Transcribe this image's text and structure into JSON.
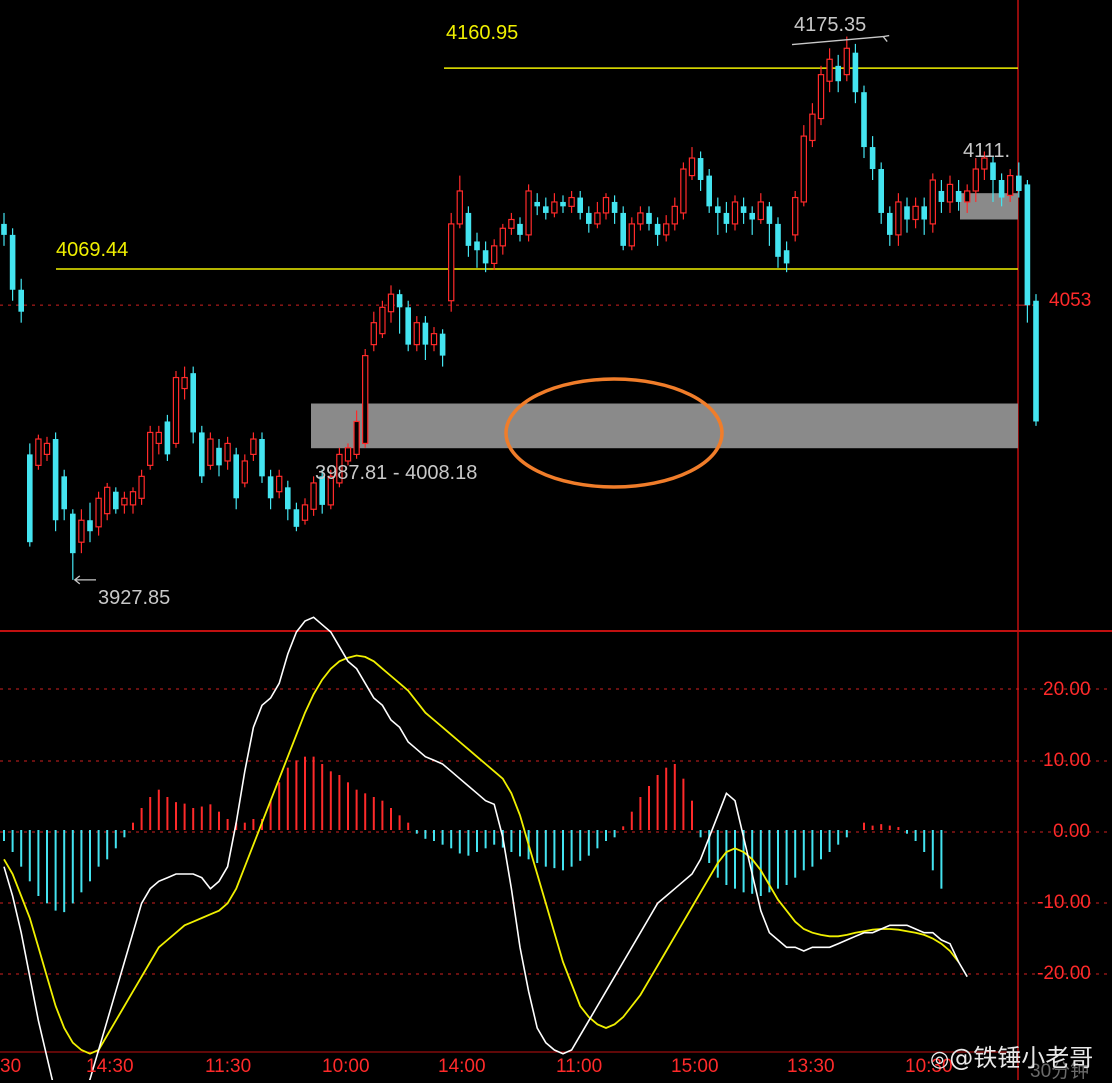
{
  "annotations": {
    "level_high": "4160.95",
    "level_mid": "4069.44",
    "peak_label": "4175.35",
    "low_label": "3927.85",
    "zone_label": "3987.81 - 4008.18",
    "last_price_partial": "4111.",
    "axis_price": "4053"
  },
  "macd_axis": [
    "20.00",
    "10.00",
    "0.00",
    "-10.00",
    "-20.00"
  ],
  "x_ticks": [
    "30",
    "14:30",
    "11:30",
    "10:00",
    "14:00",
    "11:00",
    "15:00",
    "13:30",
    "10:30"
  ],
  "period_label": "30分钟",
  "watermark": "@铁锤小老哥",
  "colors": {
    "up": "#ff2a2a",
    "down": "#44e4f0",
    "level_line": "#f0f000",
    "zone": "#8a8a8a",
    "circle": "#f07d2a",
    "dif": "#ffffff",
    "dea": "#f0f000"
  },
  "chart_data": [
    {
      "type": "candlestick",
      "ylim": [
        3905,
        4192
      ],
      "levels": [
        4160.95,
        4069.44
      ],
      "current_price_line": 4053,
      "support_zone": [
        3987.81,
        4008.18
      ],
      "resistance_zone_right": [
        4092,
        4104
      ],
      "annotated_high": 4175.35,
      "annotated_low": 3927.85,
      "candles": [
        [
          4090,
          4085,
          4095,
          4080
        ],
        [
          4085,
          4060,
          4088,
          4055
        ],
        [
          4060,
          4050,
          4065,
          4045
        ],
        [
          3985,
          3945,
          3990,
          3943
        ],
        [
          3980,
          3992,
          3994,
          3978
        ],
        [
          3985,
          3990,
          3993,
          3982
        ],
        [
          3992,
          3955,
          3995,
          3950
        ],
        [
          3975,
          3960,
          3978,
          3955
        ],
        [
          3958,
          3940,
          3960,
          3927.85
        ],
        [
          3945,
          3955,
          3960,
          3940
        ],
        [
          3955,
          3950,
          3963,
          3945
        ],
        [
          3952,
          3965,
          3968,
          3948
        ],
        [
          3958,
          3970,
          3972,
          3955
        ],
        [
          3968,
          3960,
          3970,
          3958
        ],
        [
          3962,
          3965,
          3968,
          3958
        ],
        [
          3962,
          3968,
          3970,
          3958
        ],
        [
          3965,
          3975,
          3978,
          3962
        ],
        [
          3980,
          3995,
          3998,
          3978
        ],
        [
          3990,
          3995,
          3998,
          3985
        ],
        [
          4000,
          3985,
          4003,
          3982
        ],
        [
          3990,
          4020,
          4023,
          3988
        ],
        [
          4015,
          4020,
          4025,
          4010
        ],
        [
          4022,
          3995,
          4025,
          3990
        ],
        [
          3995,
          3975,
          3998,
          3972
        ],
        [
          3980,
          3992,
          3995,
          3978
        ],
        [
          3988,
          3980,
          3992,
          3975
        ],
        [
          3982,
          3990,
          3993,
          3978
        ],
        [
          3985,
          3965,
          3988,
          3960
        ],
        [
          3972,
          3982,
          3985,
          3970
        ],
        [
          3985,
          3992,
          3995,
          3982
        ],
        [
          3992,
          3975,
          3995,
          3972
        ],
        [
          3975,
          3965,
          3978,
          3960
        ],
        [
          3968,
          3975,
          3978,
          3965
        ],
        [
          3970,
          3960,
          3973,
          3955
        ],
        [
          3960,
          3952,
          3963,
          3950
        ],
        [
          3955,
          3962,
          3965,
          3953
        ],
        [
          3960,
          3972,
          3975,
          3957
        ],
        [
          3975,
          3962,
          3978,
          3958
        ],
        [
          3962,
          3975,
          3978,
          3960
        ],
        [
          3972,
          3985,
          3988,
          3970
        ],
        [
          3982,
          3988,
          3990,
          3980
        ],
        [
          3985,
          4000,
          4005,
          3983
        ],
        [
          3990,
          4030,
          4033,
          3988
        ],
        [
          4035,
          4045,
          4050,
          4032
        ],
        [
          4040,
          4052,
          4055,
          4038
        ],
        [
          4050,
          4058,
          4062,
          4045
        ],
        [
          4058,
          4052,
          4060,
          4040
        ],
        [
          4052,
          4035,
          4055,
          4032
        ],
        [
          4035,
          4045,
          4048,
          4032
        ],
        [
          4045,
          4035,
          4048,
          4028
        ],
        [
          4035,
          4040,
          4043,
          4032
        ],
        [
          4040,
          4030,
          4042,
          4025
        ],
        [
          4055,
          4090,
          4095,
          4050
        ],
        [
          4090,
          4105,
          4112,
          4088
        ],
        [
          4095,
          4080,
          4098,
          4075
        ],
        [
          4082,
          4078,
          4086,
          4070
        ],
        [
          4078,
          4072,
          4082,
          4068
        ],
        [
          4072,
          4080,
          4083,
          4069
        ],
        [
          4080,
          4088,
          4090,
          4076
        ],
        [
          4088,
          4092,
          4095,
          4085
        ],
        [
          4090,
          4085,
          4093,
          4082
        ],
        [
          4085,
          4105,
          4108,
          4082
        ],
        [
          4100,
          4098,
          4104,
          4094
        ],
        [
          4098,
          4095,
          4102,
          4092
        ],
        [
          4095,
          4100,
          4104,
          4093
        ],
        [
          4100,
          4098,
          4103,
          4095
        ],
        [
          4098,
          4102,
          4105,
          4095
        ],
        [
          4102,
          4095,
          4105,
          4092
        ],
        [
          4095,
          4090,
          4098,
          4086
        ],
        [
          4090,
          4095,
          4100,
          4088
        ],
        [
          4095,
          4102,
          4104,
          4092
        ],
        [
          4100,
          4095,
          4103,
          4090
        ],
        [
          4095,
          4080,
          4098,
          4078
        ],
        [
          4080,
          4090,
          4093,
          4078
        ],
        [
          4090,
          4095,
          4098,
          4087
        ],
        [
          4095,
          4090,
          4098,
          4087
        ],
        [
          4090,
          4085,
          4093,
          4080
        ],
        [
          4085,
          4090,
          4094,
          4082
        ],
        [
          4090,
          4098,
          4102,
          4087
        ],
        [
          4095,
          4115,
          4118,
          4092
        ],
        [
          4112,
          4120,
          4125,
          4110
        ],
        [
          4120,
          4110,
          4123,
          4105
        ],
        [
          4112,
          4098,
          4115,
          4095
        ],
        [
          4098,
          4095,
          4102,
          4085
        ],
        [
          4095,
          4090,
          4100,
          4086
        ],
        [
          4090,
          4100,
          4103,
          4087
        ],
        [
          4098,
          4095,
          4102,
          4090
        ],
        [
          4095,
          4092,
          4098,
          4085
        ],
        [
          4092,
          4100,
          4104,
          4090
        ],
        [
          4098,
          4090,
          4100,
          4080
        ],
        [
          4090,
          4075,
          4093,
          4070
        ],
        [
          4078,
          4072,
          4082,
          4068
        ],
        [
          4085,
          4102,
          4105,
          4082
        ],
        [
          4100,
          4130,
          4135,
          4098
        ],
        [
          4128,
          4140,
          4145,
          4125
        ],
        [
          4138,
          4158,
          4162,
          4135
        ],
        [
          4155,
          4165,
          4170,
          4150
        ],
        [
          4162,
          4155,
          4167,
          4150
        ],
        [
          4158,
          4170,
          4175.35,
          4155
        ],
        [
          4168,
          4150,
          4172,
          4145
        ],
        [
          4150,
          4125,
          4153,
          4120
        ],
        [
          4125,
          4115,
          4130,
          4110
        ],
        [
          4115,
          4095,
          4118,
          4090
        ],
        [
          4095,
          4085,
          4098,
          4080
        ],
        [
          4085,
          4100,
          4104,
          4080
        ],
        [
          4098,
          4092,
          4102,
          4086
        ],
        [
          4092,
          4098,
          4102,
          4088
        ],
        [
          4098,
          4092,
          4102,
          4085
        ],
        [
          4090,
          4110,
          4113,
          4086
        ],
        [
          4105,
          4100,
          4110,
          4095
        ],
        [
          4100,
          4108,
          4112,
          4095
        ],
        [
          4105,
          4100,
          4110,
          4096
        ],
        [
          4100,
          4105,
          4108,
          4095
        ],
        [
          4105,
          4115,
          4120,
          4100
        ],
        [
          4115,
          4120,
          4123,
          4110
        ],
        [
          4118,
          4110,
          4121,
          4100
        ],
        [
          4110,
          4102,
          4113,
          4098
        ],
        [
          4103,
          4112,
          4115,
          4100
        ],
        [
          4112,
          4105,
          4118,
          4102
        ],
        [
          4108,
          4053,
          4110,
          4045
        ],
        [
          4055,
          4000,
          4058,
          3998
        ]
      ]
    },
    {
      "type": "macd",
      "ylim": [
        -30,
        27
      ],
      "dif": [
        -5,
        -9,
        -14,
        -20,
        -26,
        -31,
        -36,
        -38,
        -38.5,
        -37,
        -34,
        -30,
        -26,
        -22,
        -18,
        -14,
        -10,
        -8,
        -7,
        -6.5,
        -6,
        -6,
        -6,
        -6.5,
        -8,
        -7,
        -5,
        1,
        8,
        14,
        17,
        18,
        20,
        24,
        27,
        28.5,
        29,
        28,
        27,
        25,
        23,
        22,
        20,
        18,
        17,
        15,
        14,
        12,
        11,
        10,
        9.5,
        9,
        8,
        7,
        6,
        5,
        4,
        3.5,
        -1,
        -8,
        -16,
        -22,
        -27,
        -29,
        -30,
        -30.5,
        -30,
        -28,
        -26,
        -24,
        -22,
        -20,
        -18,
        -16,
        -14,
        -12,
        -10,
        -9,
        -8,
        -7,
        -6,
        -4,
        -1,
        2,
        5,
        4,
        -1,
        -6,
        -11,
        -14,
        -15,
        -16,
        -16,
        -16.5,
        -16,
        -16,
        -16,
        -15.5,
        -15,
        -14.5,
        -14,
        -14,
        -13.5,
        -13,
        -13,
        -13,
        -13.5,
        -14,
        -14,
        -15,
        -15.5,
        -18,
        -20
      ],
      "dea": [
        -4,
        -6,
        -9,
        -12,
        -16,
        -20,
        -24,
        -27,
        -29,
        -30,
        -30.5,
        -30,
        -28,
        -26,
        -24,
        -22,
        -20,
        -18,
        -16,
        -15,
        -14,
        -13,
        -12.5,
        -12,
        -11.5,
        -11,
        -10,
        -8,
        -5,
        -2,
        1,
        4,
        7,
        10,
        13,
        16,
        18.5,
        20.5,
        22,
        23,
        23.5,
        23.8,
        23.6,
        23,
        22,
        21,
        20,
        19,
        17.5,
        16,
        15,
        14,
        13,
        12,
        11,
        10,
        9,
        8,
        7,
        5,
        2,
        -2,
        -6,
        -10,
        -14,
        -18,
        -21,
        -24,
        -25.5,
        -26.5,
        -27,
        -26.5,
        -25.5,
        -24,
        -22.5,
        -20.5,
        -18.5,
        -16.5,
        -14.5,
        -12.5,
        -10.5,
        -8.5,
        -6.5,
        -4.5,
        -3,
        -2.5,
        -3,
        -4,
        -5.5,
        -7.5,
        -9.5,
        -11,
        -12.5,
        -13.5,
        -14,
        -14.3,
        -14.5,
        -14.5,
        -14.3,
        -14,
        -13.8,
        -13.6,
        -13.5,
        -13.5,
        -13.6,
        -13.8,
        -14,
        -14.3,
        -14.8,
        -15.5,
        -16.5,
        -18
      ],
      "histogram": [
        -1.5,
        -3,
        -5,
        -7,
        -9,
        -10,
        -11,
        -11.2,
        -10,
        -8.5,
        -7,
        -5,
        -4,
        -2.5,
        -1,
        1,
        3,
        4.5,
        5.5,
        4.5,
        3.8,
        3.6,
        3,
        3.2,
        3.5,
        2.5,
        1.5,
        1,
        1,
        1.5,
        1.5,
        4,
        6.5,
        8.5,
        9.5,
        10,
        10,
        9,
        8,
        7.5,
        6.5,
        5.5,
        5,
        4.5,
        4,
        3,
        2,
        1,
        -0.5,
        -1.2,
        -1.5,
        -2,
        -2.5,
        -3.2,
        -3.5,
        -3,
        -2.5,
        -2,
        -2.4,
        -3,
        -3.6,
        -4,
        -4.5,
        -5,
        -5.2,
        -5.5,
        -5,
        -4.2,
        -3.5,
        -2.5,
        -1.5,
        -1,
        0.5,
        2.5,
        4.5,
        6,
        7.5,
        8.5,
        9,
        7,
        4,
        -1,
        -4.5,
        -6.5,
        -7.5,
        -8,
        -8.5,
        -8.7,
        -9,
        -8.5,
        -8,
        -7.5,
        -6.5,
        -5.5,
        -5,
        -4,
        -3,
        -2,
        -1,
        0,
        1,
        0.6,
        0.8,
        0.6,
        0.4,
        -0.5,
        -1.5,
        -3,
        -5.5,
        -8
      ]
    }
  ]
}
